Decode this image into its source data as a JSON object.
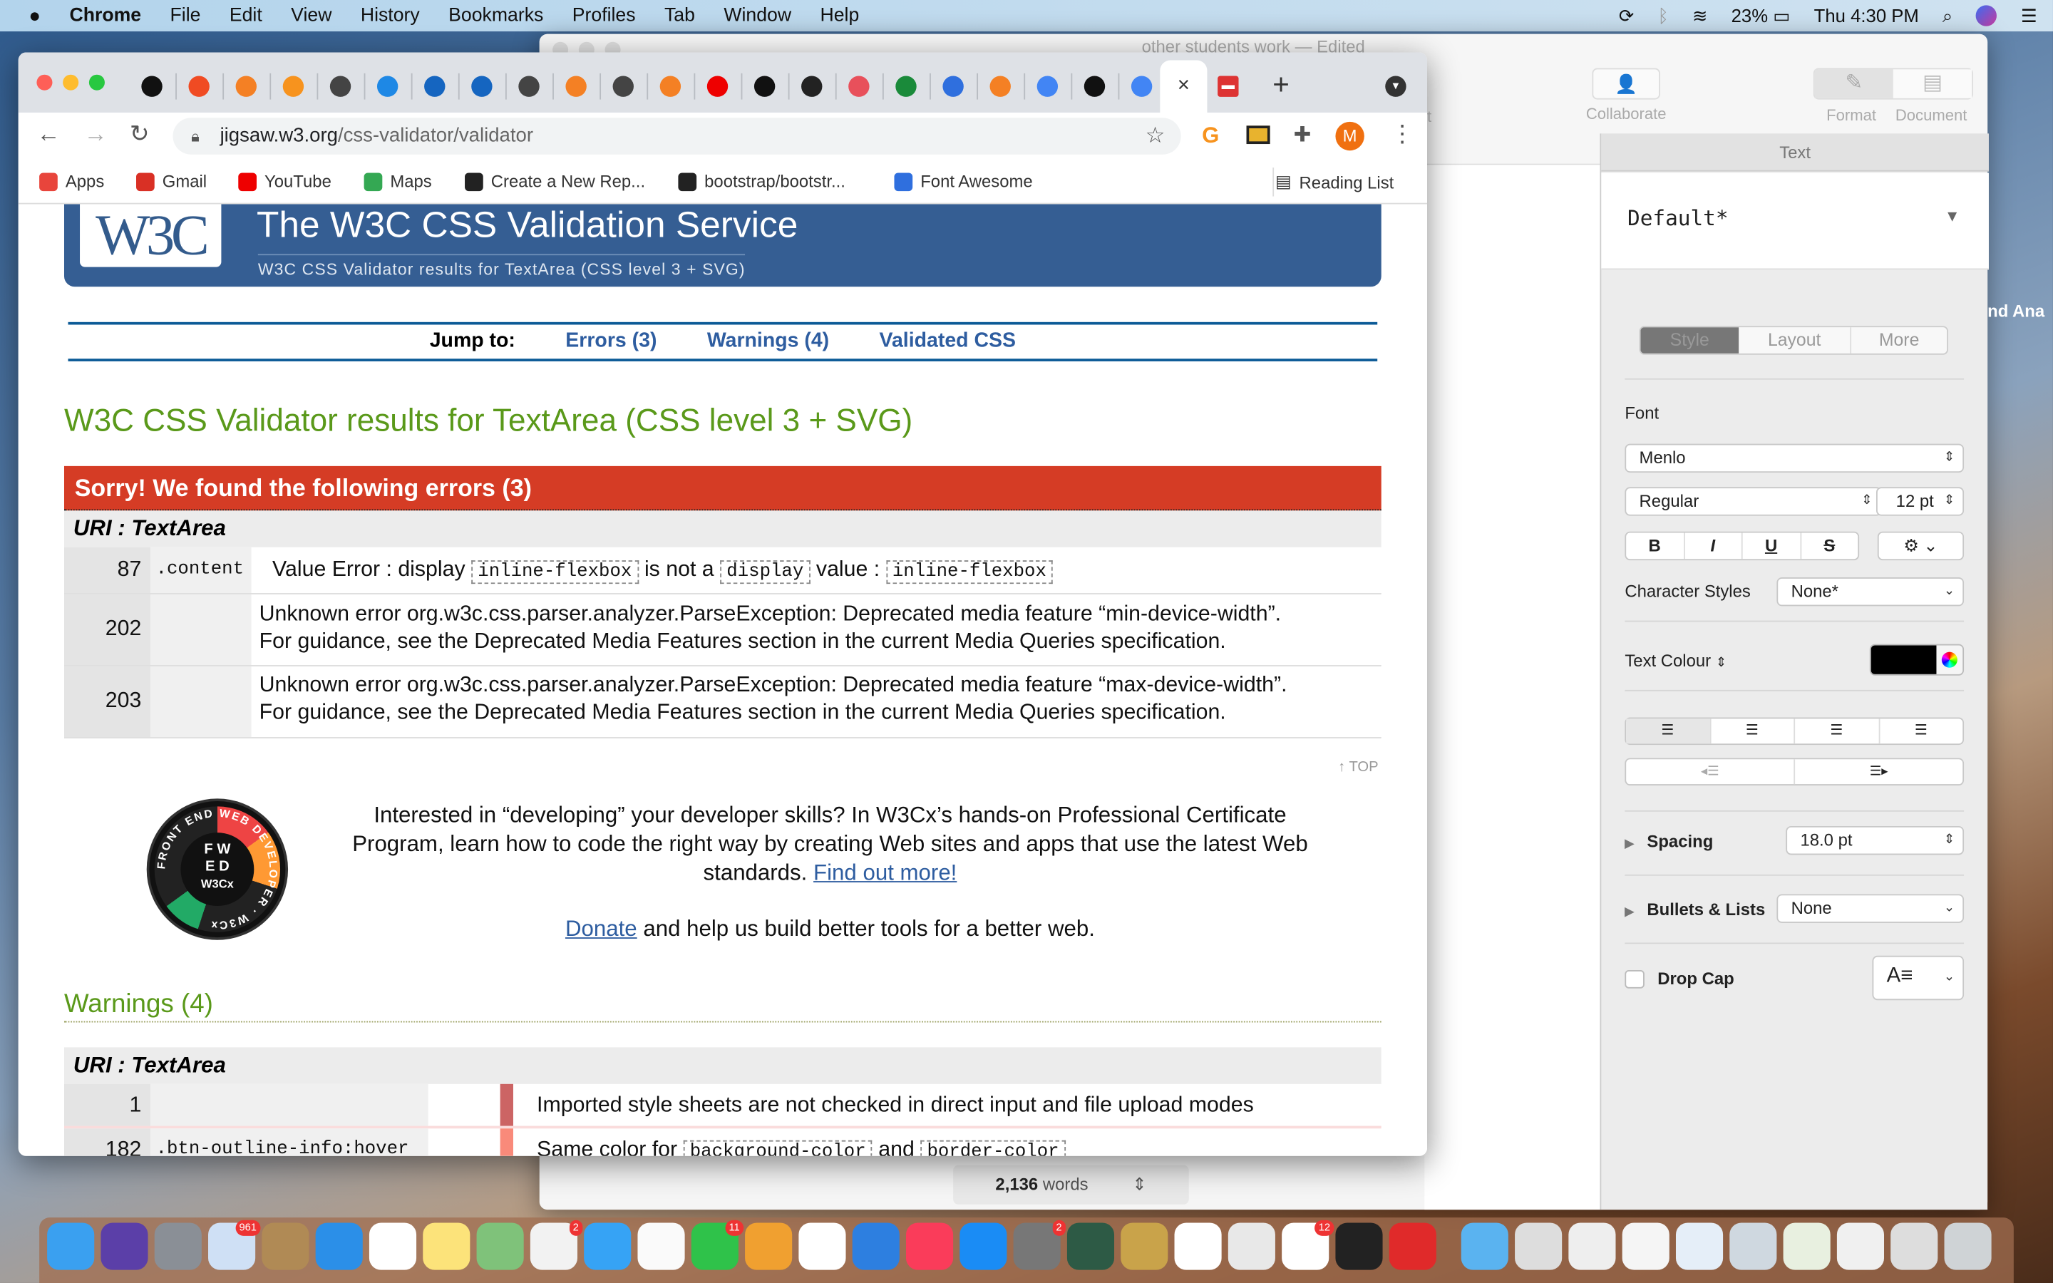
{
  "menubar": {
    "app": "Chrome",
    "items": [
      "File",
      "Edit",
      "View",
      "History",
      "Bookmarks",
      "Profiles",
      "Tab",
      "Window",
      "Help"
    ],
    "battery": "23%",
    "clock": "Thu 4:30 PM"
  },
  "pages": {
    "title": "other students work — Edited",
    "toolbar": {
      "collaborate": "Collaborate",
      "format": "Format",
      "document": "Document",
      "partial_label": "t"
    },
    "panel": {
      "header": "Text",
      "style_name": "Default*",
      "tabs": [
        "Style",
        "Layout",
        "More"
      ],
      "active_tab": "Style",
      "font_label": "Font",
      "font_family": "Menlo",
      "font_style": "Regular",
      "font_size": "12 pt",
      "bold": "B",
      "italic": "I",
      "underline": "U",
      "strike": "S",
      "char_styles_label": "Character Styles",
      "char_styles_value": "None*",
      "text_colour_label": "Text Colour",
      "text_colour": "#000000",
      "spacing_label": "Spacing",
      "spacing_value": "18.0 pt",
      "bullets_label": "Bullets & Lists",
      "bullets_value": "None",
      "drop_cap_label": "Drop Cap",
      "drop_cap_checked": false
    },
    "word_count_number": "2,136",
    "word_count_label": "words",
    "desktop_label": "nd Ana"
  },
  "chrome": {
    "tabs": [
      {
        "icon": "black-red-icon",
        "color": "#111"
      },
      {
        "icon": "opera-icon",
        "color": "#f04b23"
      },
      {
        "icon": "stackoverflow-icon",
        "color": "#f48024"
      },
      {
        "icon": "g-orange-icon",
        "color": "#f7931e"
      },
      {
        "icon": "globe-icon",
        "color": "#444"
      },
      {
        "icon": "hexagon-icon",
        "color": "#1e88e5"
      },
      {
        "icon": "terminal-blue-icon",
        "color": "#1565c0"
      },
      {
        "icon": "terminal-blue-icon",
        "color": "#1565c0"
      },
      {
        "icon": "globe-icon",
        "color": "#444"
      },
      {
        "icon": "stackoverflow-icon",
        "color": "#f48024"
      },
      {
        "icon": "globe-icon",
        "color": "#444"
      },
      {
        "icon": "stackoverflow-icon",
        "color": "#f48024"
      },
      {
        "icon": "youtube-icon",
        "color": "#e00"
      },
      {
        "icon": "codepen-icon",
        "color": "#111"
      },
      {
        "icon": "github-icon",
        "color": "#222"
      },
      {
        "icon": "asterisk-icon",
        "color": "#e8505b"
      },
      {
        "icon": "w-green-icon",
        "color": "#1a8a3a"
      },
      {
        "icon": "bookmark-blue-icon",
        "color": "#2f6fde"
      },
      {
        "icon": "stackoverflow-icon",
        "color": "#f48024"
      },
      {
        "icon": "google-icon",
        "color": "#4285f4"
      },
      {
        "icon": "k-icon",
        "color": "#111"
      },
      {
        "icon": "google-icon",
        "color": "#4285f4"
      }
    ],
    "active_tab_close": "×",
    "red_tab_icon": "red-doc-icon",
    "new_tab": "+",
    "url_host": "jigsaw.w3.org",
    "url_path": "/css-validator/validator",
    "profile_initial": "M",
    "bookmarks": [
      {
        "label": "Apps",
        "color": "#e8453c"
      },
      {
        "label": "Gmail",
        "color": "#d93025"
      },
      {
        "label": "YouTube",
        "color": "#e00"
      },
      {
        "label": "Maps",
        "color": "#34a853"
      },
      {
        "label": "Create a New Rep...",
        "color": "#222"
      },
      {
        "label": "bootstrap/bootstr...",
        "color": "#222"
      },
      {
        "label": "Font Awesome",
        "color": "#2f6fde"
      }
    ],
    "reading_list": "Reading List"
  },
  "page": {
    "logo": "W3C",
    "banner_title": "The W3C CSS Validation Service",
    "banner_subtitle": "W3C CSS Validator results for TextArea (CSS level 3 + SVG)",
    "jump_label": "Jump to:",
    "jump_links": [
      "Errors (3)",
      "Warnings (4)",
      "Validated CSS"
    ],
    "heading": "W3C CSS Validator results for TextArea (CSS level 3 + SVG)",
    "errors_title": "Sorry! We found the following errors (3)",
    "uri_label": "URI : TextArea",
    "errors": [
      {
        "line": "87",
        "context": ".content",
        "pre": "Value Error : display",
        "code1": "inline-flexbox",
        "mid": "is not a",
        "code2": "display",
        "mid2": "value :",
        "code3": "inline-flexbox"
      },
      {
        "line": "202",
        "context": "",
        "l1": "Unknown error org.w3c.css.parser.analyzer.ParseException: Deprecated media feature “min-device-width”.",
        "l2": "For guidance, see the Deprecated Media Features section in the current Media Queries specification."
      },
      {
        "line": "203",
        "context": "",
        "l1": "Unknown error org.w3c.css.parser.analyzer.ParseException: Deprecated media feature “max-device-width”.",
        "l2": "For guidance, see the Deprecated Media Features section in the current Media Queries specification."
      }
    ],
    "top_link": "↑ TOP",
    "badge_text": "FRONT END WEB DEVELOPER · W3Cx",
    "badge_letters": [
      "F",
      "E",
      "W",
      "D"
    ],
    "badge_brand": "W3Cx",
    "promo_text": "Interested in “developing” your developer skills? In W3Cx’s hands-on Professional Certificate Program, learn how to code the right way by creating Web sites and apps that use the latest Web standards.",
    "promo_link": "Find out more!",
    "donate_link": "Donate",
    "donate_text": "and help us build better tools for a better web.",
    "warnings_heading": "Warnings (4)",
    "warnings": [
      {
        "line": "1",
        "context": "",
        "msg": "Imported style sheets are not checked in direct input and file upload modes"
      },
      {
        "line": "182",
        "context": ".btn-outline-info:hover",
        "pre": "Same color for",
        "code1": "background-color",
        "mid": "and",
        "code2": "border-color"
      }
    ]
  },
  "dock": {
    "apps": [
      {
        "name": "finder",
        "color": "#3aa0f0"
      },
      {
        "name": "siri",
        "color": "#5b3fa8"
      },
      {
        "name": "launchpad",
        "color": "#8a8f96"
      },
      {
        "name": "mail",
        "color": "#cfe0f5",
        "badge": "961"
      },
      {
        "name": "contacts",
        "color": "#b08a55"
      },
      {
        "name": "safari",
        "color": "#2b8fe8"
      },
      {
        "name": "calendar",
        "color": "#fff"
      },
      {
        "name": "notes",
        "color": "#fce37a"
      },
      {
        "name": "maps",
        "color": "#7fc27a"
      },
      {
        "name": "photos",
        "color": "#f2f2f2",
        "badge": "2"
      },
      {
        "name": "messages",
        "color": "#36a3f5"
      },
      {
        "name": "reminders",
        "color": "#fafafa"
      },
      {
        "name": "facetime",
        "color": "#2fc24a",
        "badge": "11"
      },
      {
        "name": "pages",
        "color": "#f0a030"
      },
      {
        "name": "numbers",
        "color": "#fff"
      },
      {
        "name": "keynote",
        "color": "#2d7fe0"
      },
      {
        "name": "music",
        "color": "#fa3c5a"
      },
      {
        "name": "app-store",
        "color": "#1a8cf5"
      },
      {
        "name": "system-preferences",
        "color": "#777",
        "badge": "2"
      },
      {
        "name": "downloads",
        "color": "#2d5a45"
      },
      {
        "name": "keychain",
        "color": "#c9a34a"
      },
      {
        "name": "smiley",
        "color": "#fff"
      },
      {
        "name": "chrome",
        "color": "#e8e8e8"
      },
      {
        "name": "slack",
        "color": "#fff",
        "badge": "12"
      },
      {
        "name": "terminal",
        "color": "#222"
      },
      {
        "name": "red-app",
        "color": "#e02a2a"
      },
      {
        "name": "folder",
        "color": "#5ab3f0"
      },
      {
        "name": "preview-1",
        "color": "#ddd"
      },
      {
        "name": "preview-2",
        "color": "#eee"
      },
      {
        "name": "preview-3",
        "color": "#f5f5f5"
      },
      {
        "name": "preview-4",
        "color": "#e5eef8"
      },
      {
        "name": "preview-5",
        "color": "#cfd8e0"
      },
      {
        "name": "preview-6",
        "color": "#e8f0e0"
      },
      {
        "name": "preview-7",
        "color": "#f0f0f0"
      },
      {
        "name": "preview-8",
        "color": "#ddd"
      },
      {
        "name": "trash",
        "color": "#cfd3d6"
      }
    ]
  }
}
